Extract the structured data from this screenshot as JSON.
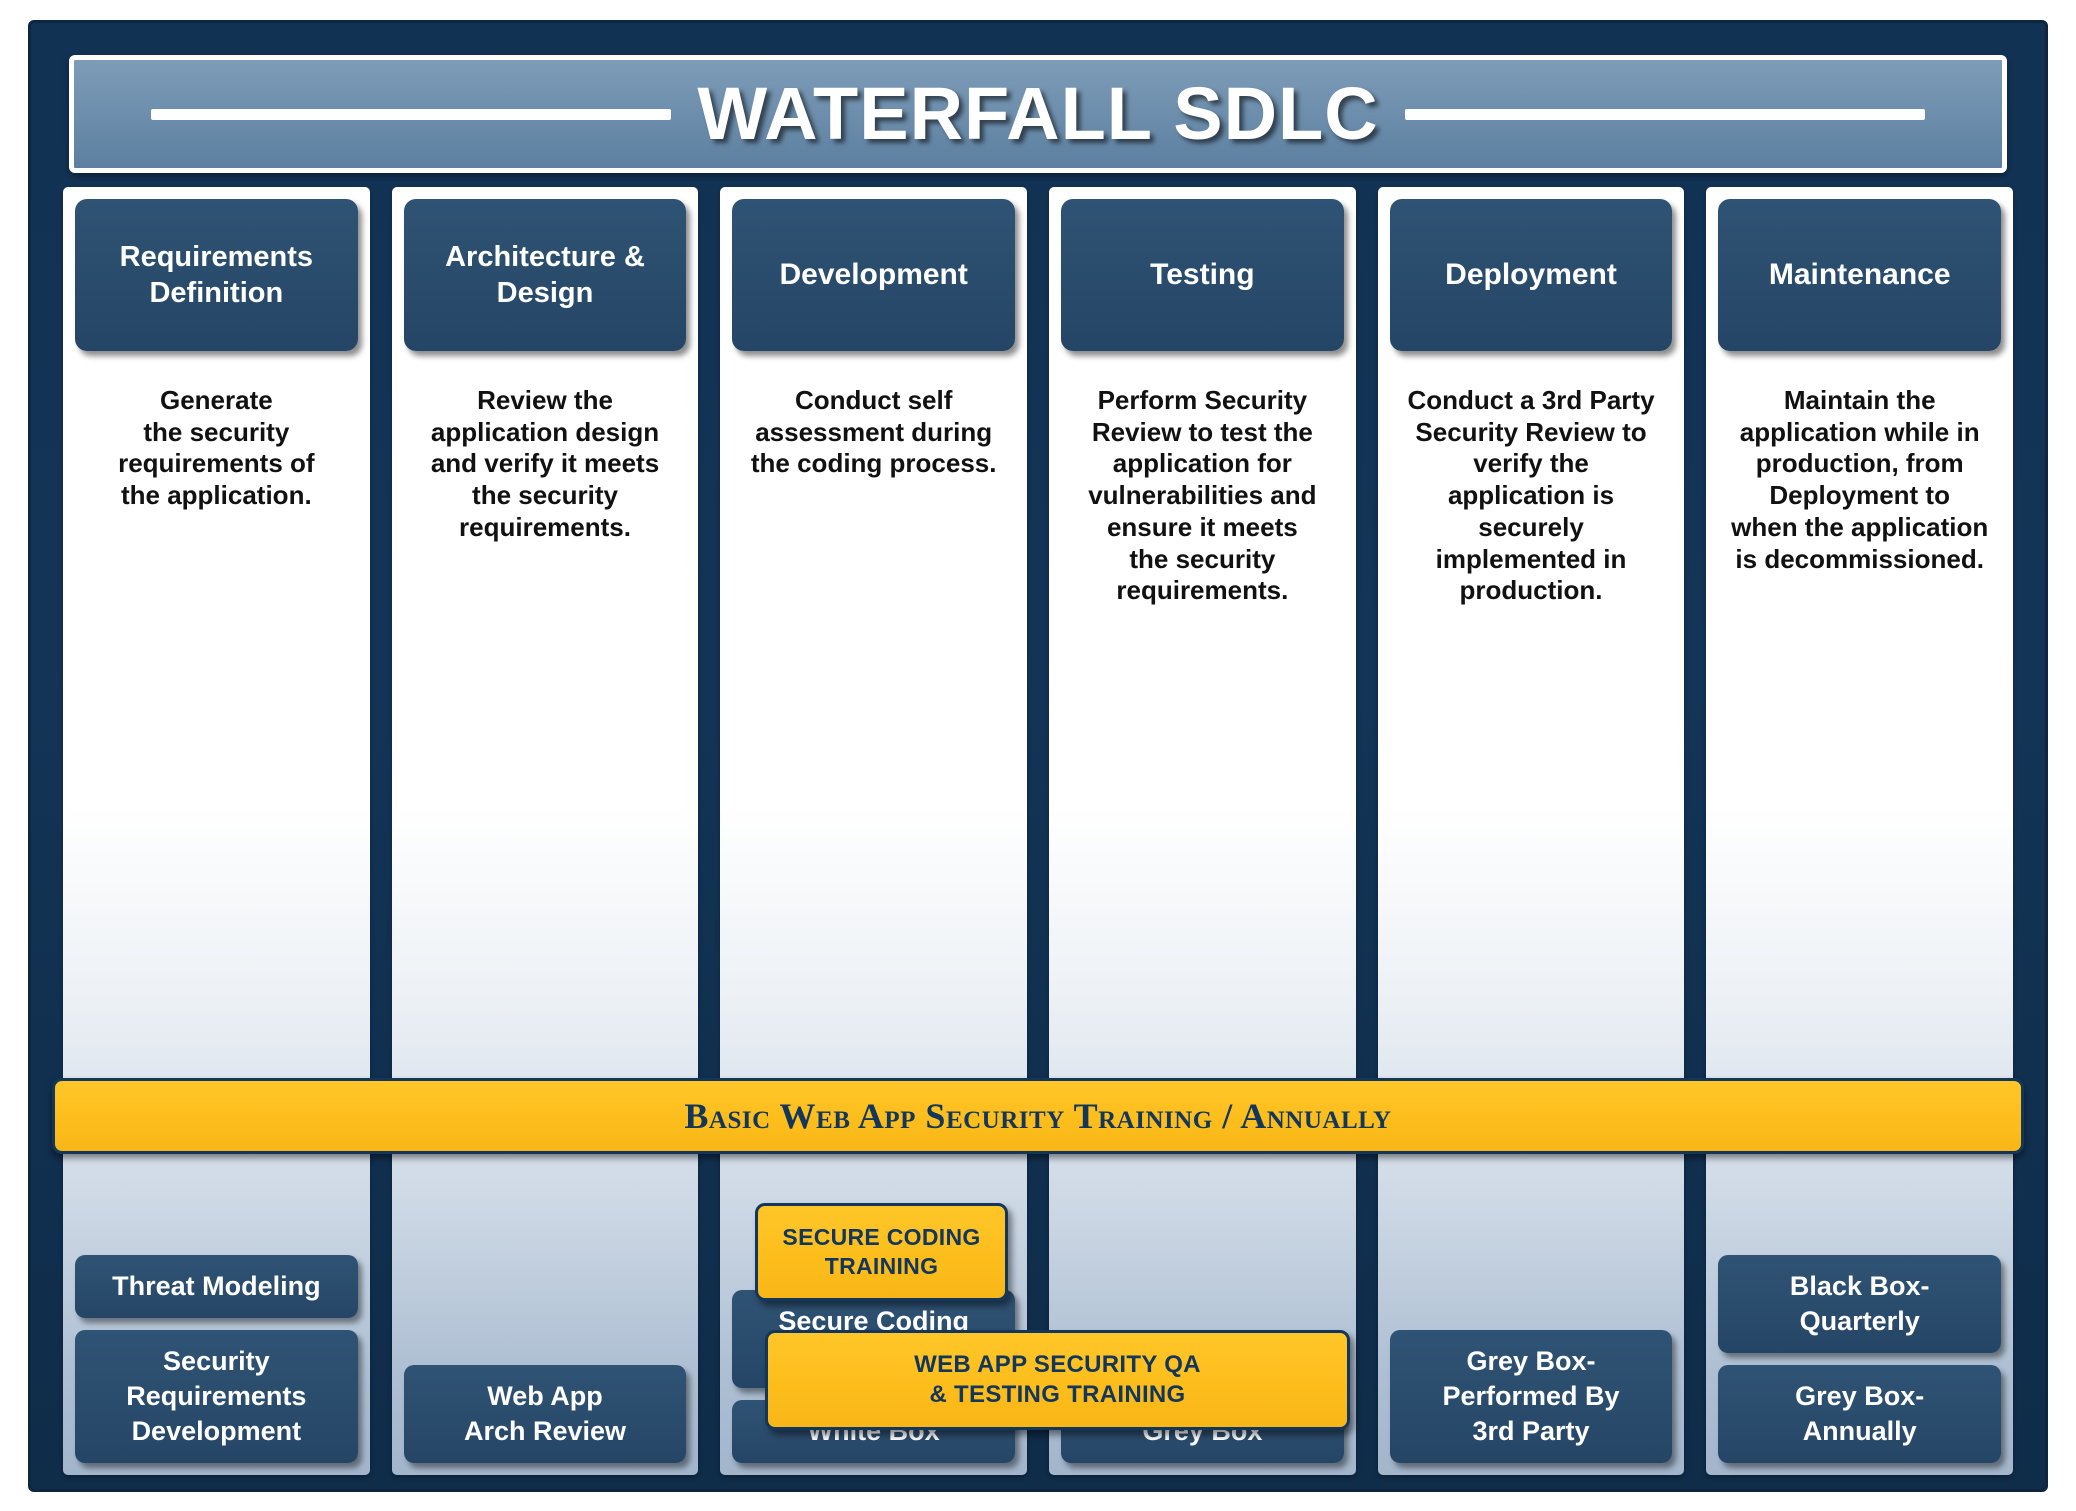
{
  "header": {
    "title": "WATERFALL SDLC"
  },
  "colors": {
    "frame_navy": "#133456",
    "chip_blue": "#2b4d6d",
    "banner_blue": "#6d8eac",
    "accent_yellow": "#FFC629",
    "accent_text_navy": "#12365C"
  },
  "phases": [
    {
      "name": "Requirements\nDefinition",
      "description": "Generate\nthe security\nrequirements of\nthe application.",
      "badges": [
        "Threat Modeling",
        "Security\nRequirements\nDevelopment"
      ]
    },
    {
      "name": "Architecture\n& Design",
      "description": "Review the\napplication design\nand verify it meets\nthe security\nrequirements.",
      "badges": [
        "Web App\nArch Review"
      ]
    },
    {
      "name": "Development",
      "description": "Conduct self\nassessment during\nthe coding process.",
      "badges": [
        "Secure Coding\nPractices",
        "White Box"
      ]
    },
    {
      "name": "Testing",
      "description": "Perform Security\nReview to test the\napplication for\nvulnerabilities and\nensure it meets\nthe security\nrequirements.",
      "badges": [
        "Grey Box"
      ]
    },
    {
      "name": "Deployment",
      "description": "Conduct a 3rd Party\nSecurity Review to\nverify the\napplication is\nsecurely\nimplemented in\nproduction.",
      "badges": [
        "Grey Box-\nPerformed By\n3rd Party"
      ]
    },
    {
      "name": "Maintenance",
      "description": "Maintain the\napplication while in\nproduction, from\nDeployment to\nwhen the application\nis decommissioned.",
      "badges": [
        "Black Box-\nQuarterly",
        "Grey Box-\nAnnually"
      ]
    }
  ],
  "training": {
    "basic_bar": "Basic Web App Security Training / Annually",
    "secure_coding": "SECURE CODING\nTRAINING",
    "qa_testing": "WEB APP SECURITY QA\n& TESTING TRAINING"
  }
}
